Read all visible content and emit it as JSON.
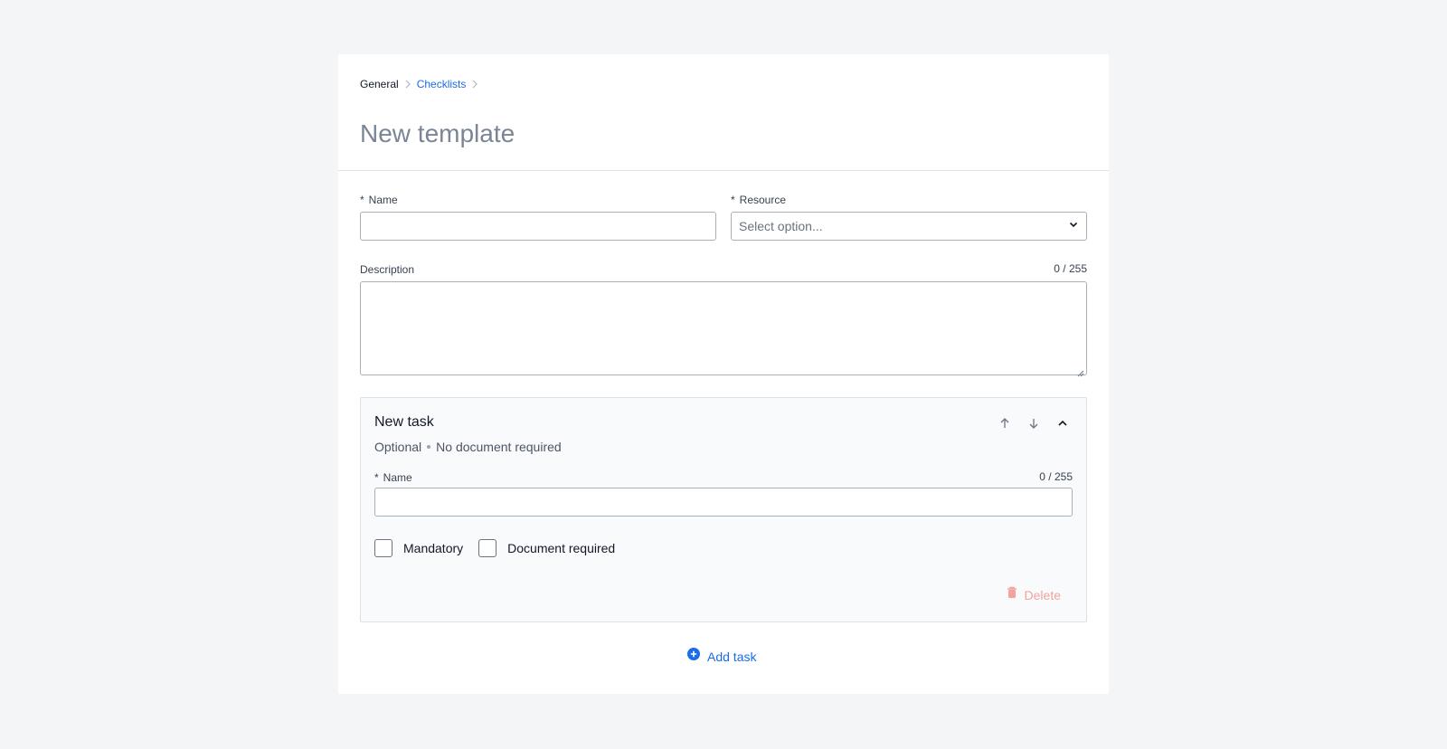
{
  "breadcrumb": {
    "items": [
      "General",
      "Checklists"
    ]
  },
  "page": {
    "title": "New template"
  },
  "form": {
    "name_label": "Name",
    "required_marker": "*",
    "resource_label": "Resource",
    "resource_placeholder": "Select option...",
    "description_label": "Description",
    "description_counter": "0 / 255"
  },
  "task": {
    "title": "New task",
    "meta_optional": "Optional",
    "meta_document": "No document required",
    "name_label": "Name",
    "name_counter": "0 / 255",
    "mandatory_label": "Mandatory",
    "document_required_label": "Document required",
    "delete_label": "Delete"
  },
  "actions": {
    "add_task_label": "Add task"
  },
  "colors": {
    "accent": "#1a6ce8",
    "delete": "#f0a49d",
    "title": "#7b8596"
  },
  "icons": {
    "breadcrumb_separator": "chevron-right-icon",
    "select": "chevron-down-icon",
    "move_up": "arrow-up-icon",
    "move_down": "arrow-down-icon",
    "collapse": "chevron-up-icon",
    "delete": "trash-icon",
    "add": "plus-circle-icon"
  }
}
